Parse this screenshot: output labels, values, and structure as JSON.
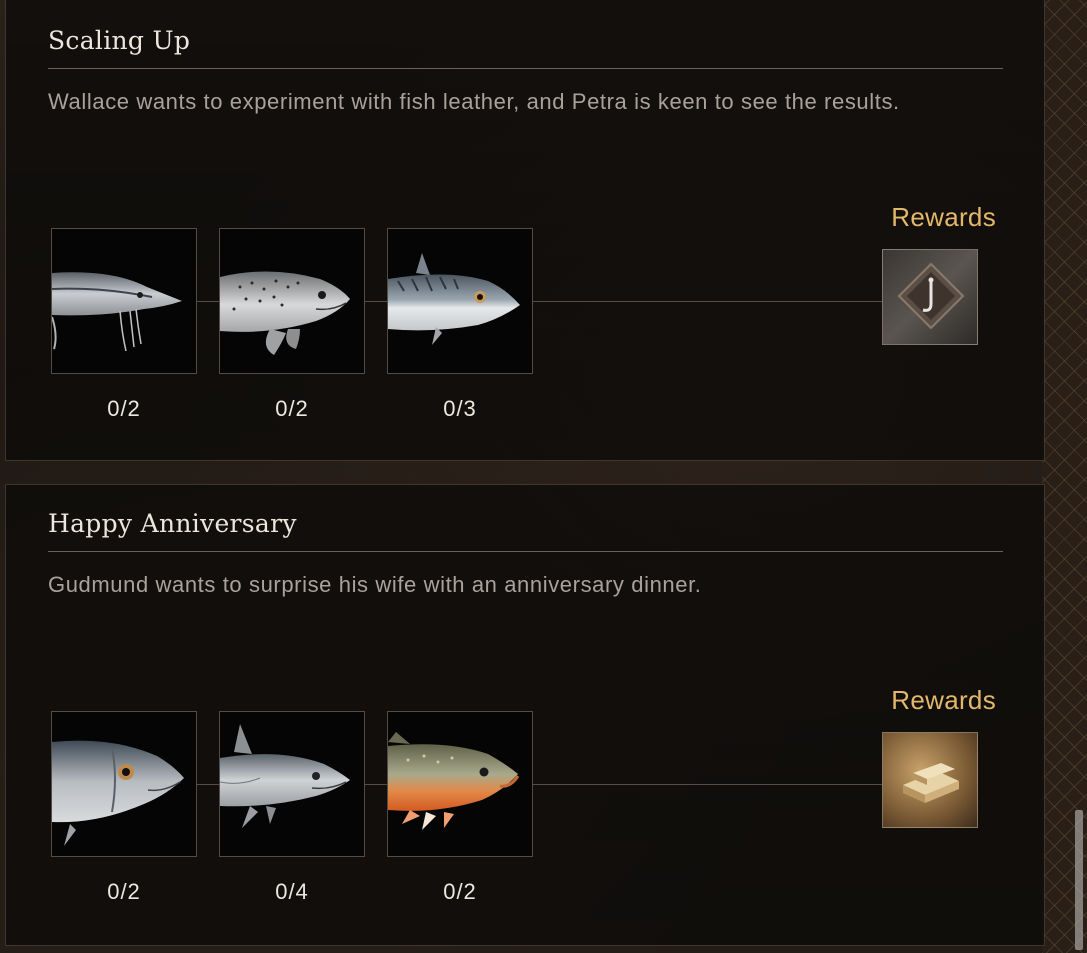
{
  "quests": [
    {
      "title": "Scaling Up",
      "description": "Wallace wants to experiment with fish leather, and Petra is keen to see the results.",
      "rewards_label": "Rewards",
      "items": [
        {
          "icon": "sturgeon-fish-icon",
          "count": "0/2"
        },
        {
          "icon": "trout-fish-icon",
          "count": "0/2"
        },
        {
          "icon": "mackerel-fish-icon",
          "count": "0/3"
        }
      ],
      "reward_icon": "hook-pendant-reward-icon"
    },
    {
      "title": "Happy Anniversary",
      "description": "Gudmund wants to surprise his wife with an anniversary dinner.",
      "rewards_label": "Rewards",
      "items": [
        {
          "icon": "salmon-fish-icon",
          "count": "0/2"
        },
        {
          "icon": "herring-fish-icon",
          "count": "0/4"
        },
        {
          "icon": "char-fish-icon",
          "count": "0/2"
        }
      ],
      "reward_icon": "silver-ingots-reward-icon"
    }
  ],
  "colors": {
    "title": "#ede6dc",
    "description": "#a8a29b",
    "rewards": "#e3b86b",
    "count": "#ece7e0"
  }
}
